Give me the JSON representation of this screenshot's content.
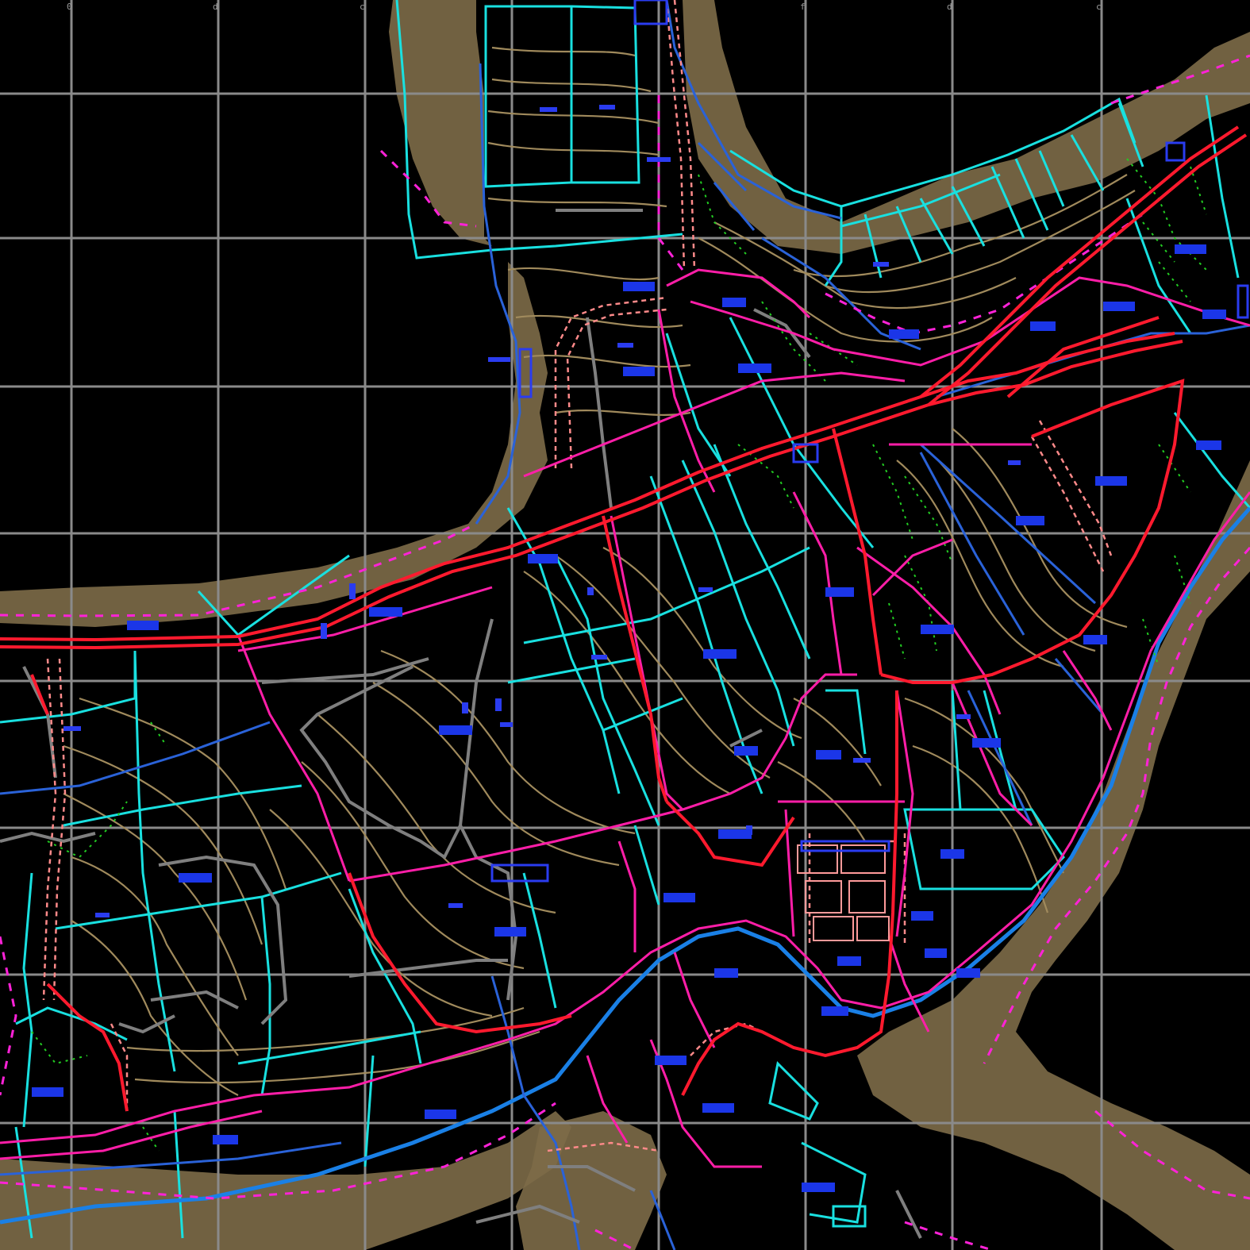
{
  "map": {
    "description_colors": {
      "background": "#000000",
      "grid": "#8a8a8a",
      "contour": "#a08a5c",
      "parcel_boundary": "#19e0e0",
      "main_road": "#ff1a2e",
      "secondary_road": "#ff1ea8",
      "river": "#1a80e6",
      "vegetation": "#22cc22",
      "labels": "#1b36e8"
    },
    "grid_labels": [
      "0",
      "d",
      "c",
      "f",
      "d",
      "c"
    ],
    "plot_labels": [
      "",
      "",
      "",
      "",
      "",
      "",
      "",
      "",
      "",
      "",
      "",
      "",
      "",
      "",
      "",
      "",
      "",
      "",
      "",
      "",
      "",
      "",
      "",
      "",
      "",
      "",
      "",
      "",
      "",
      "",
      "",
      "",
      "",
      "",
      "",
      "",
      "",
      "",
      "",
      ""
    ]
  }
}
